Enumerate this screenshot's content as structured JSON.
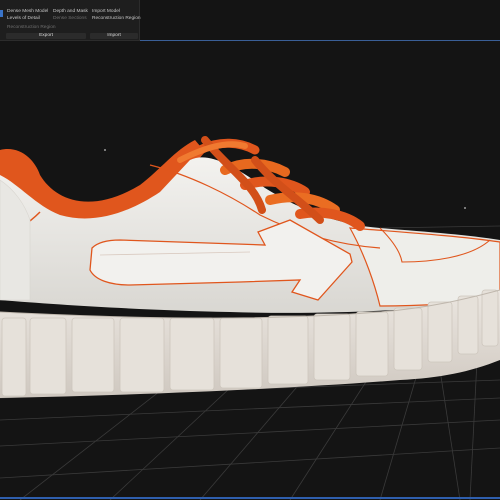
{
  "toolbar": {
    "row1": [
      "Dense Mesh Model",
      "Depth and Mask",
      "Import Model"
    ],
    "row2": [
      "Levels of Detail",
      "Dense Sections",
      "Reconstruction Region"
    ],
    "row3": [
      "Reconstruction Region"
    ],
    "export_label": "Export",
    "import_label": "Import",
    "accent_color": "#3a74c9"
  },
  "viewport": {
    "background_color": "#141414",
    "grid_color": "#3a3a3a",
    "model": "sneaker",
    "model_colors": {
      "upper": "#ecebe7",
      "trim": "#e0561d",
      "sole": "#e4dfd9"
    }
  }
}
